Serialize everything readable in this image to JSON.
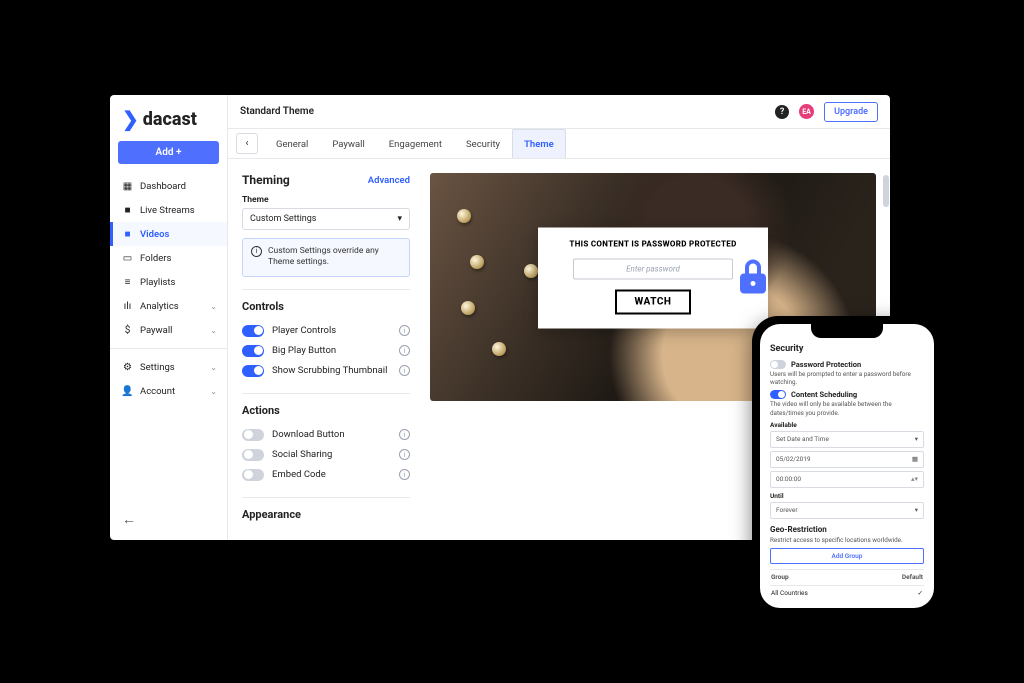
{
  "brand": {
    "name": "dacast"
  },
  "header": {
    "title": "Standard Theme",
    "avatar_initials": "EA",
    "upgrade": "Upgrade"
  },
  "sidebar": {
    "add_button": "Add +",
    "items": [
      {
        "label": "Dashboard",
        "icon": "grid-icon"
      },
      {
        "label": "Live Streams",
        "icon": "camera-icon"
      },
      {
        "label": "Videos",
        "icon": "video-icon"
      },
      {
        "label": "Folders",
        "icon": "folder-icon"
      },
      {
        "label": "Playlists",
        "icon": "list-icon"
      },
      {
        "label": "Analytics",
        "icon": "chart-icon",
        "expandable": true
      },
      {
        "label": "Paywall",
        "icon": "dollar-icon",
        "expandable": true
      }
    ],
    "footer_items": [
      {
        "label": "Settings",
        "icon": "gear-icon",
        "expandable": true
      },
      {
        "label": "Account",
        "icon": "account-icon",
        "expandable": true
      }
    ],
    "active_index": 2
  },
  "tabs": {
    "items": [
      "General",
      "Paywall",
      "Engagement",
      "Security",
      "Theme"
    ],
    "active_index": 4
  },
  "theming": {
    "heading": "Theming",
    "advanced": "Advanced",
    "theme_label": "Theme",
    "theme_value": "Custom Settings",
    "notice": "Custom Settings override any Theme settings."
  },
  "controls": {
    "heading": "Controls",
    "rows": [
      {
        "label": "Player Controls",
        "on": true
      },
      {
        "label": "Big Play Button",
        "on": true
      },
      {
        "label": "Show Scrubbing Thumbnail",
        "on": true
      }
    ]
  },
  "actions": {
    "heading": "Actions",
    "rows": [
      {
        "label": "Download Button",
        "on": false
      },
      {
        "label": "Social Sharing",
        "on": false
      },
      {
        "label": "Embed Code",
        "on": false
      }
    ]
  },
  "appearance": {
    "heading": "Appearance"
  },
  "overlay": {
    "title": "THIS CONTENT IS PASSWORD PROTECTED",
    "placeholder": "Enter password",
    "watch": "WATCH"
  },
  "phone": {
    "security_heading": "Security",
    "password_protection_label": "Password Protection",
    "password_protection_desc": "Users will be prompted to enter a password before watching.",
    "password_protection_on": false,
    "content_scheduling_label": "Content Scheduling",
    "content_scheduling_desc": "The video will only be available between the dates/times you provide.",
    "content_scheduling_on": true,
    "available_label": "Available",
    "available_mode": "Set Date and Time",
    "available_date": "05/02/2019",
    "available_time": "00:00:00",
    "until_label": "Until",
    "until_value": "Forever",
    "geo_heading": "Geo-Restriction",
    "geo_desc": "Restrict access to specific locations worldwide.",
    "add_group": "Add Group",
    "group_col": "Group",
    "default_col": "Default",
    "group_row_name": "All Countries"
  }
}
